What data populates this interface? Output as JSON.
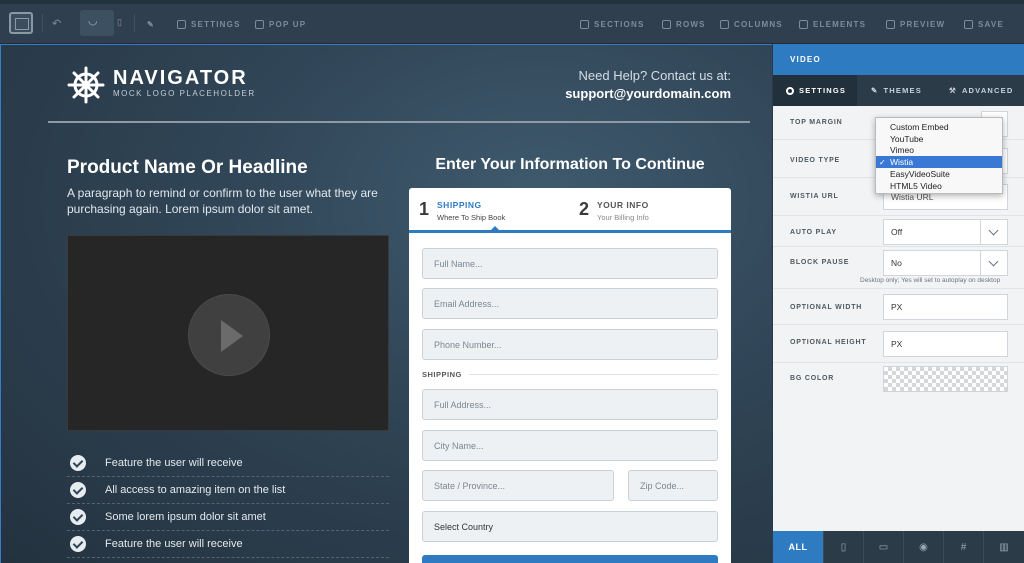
{
  "toolbar": {
    "settings": "SETTINGS",
    "popup": "POP UP",
    "sections": "SECTIONS",
    "rows": "ROWS",
    "columns": "COLUMNS",
    "elements": "ELEMENTS",
    "preview": "PREVIEW",
    "save": "SAVE"
  },
  "page": {
    "brand_name": "NAVIGATOR",
    "brand_sub": "MOCK LOGO PLACEHOLDER",
    "help_line": "Need Help? Contact us at:",
    "help_email": "support@yourdomain.com",
    "headline": "Product Name Or Headline",
    "paragraph": "A paragraph to remind or confirm to the user what they are purchasing again. Lorem ipsum dolor sit amet.",
    "features": [
      "Feature the user will receive",
      "All access to amazing item on the list",
      "Some lorem ipsum dolor sit amet",
      "Feature the user will receive"
    ],
    "form_title": "Enter Your Information To Continue"
  },
  "form": {
    "step1_num": "1",
    "step1_label": "SHIPPING",
    "step1_sub": "Where To Ship Book",
    "step2_num": "2",
    "step2_label": "YOUR INFO",
    "step2_sub": "Your Billing Info",
    "full_name": "Full Name...",
    "email": "Email Address...",
    "phone": "Phone Number...",
    "shipping_label": "SHIPPING",
    "full_address": "Full Address...",
    "city": "City Name...",
    "state": "State / Province...",
    "zip": "Zip Code...",
    "country": "Select Country"
  },
  "panel": {
    "title": "VIDEO",
    "tabs": {
      "settings": "SETTINGS",
      "themes": "THEMES",
      "advanced": "ADVANCED"
    },
    "top_margin_label": "TOP MARGIN",
    "video_type_label": "VIDEO TYPE",
    "wistia_url_label": "WISTIA URL",
    "wistia_url_value": "Wistia URL",
    "auto_play_label": "AUTO PLAY",
    "auto_play_value": "Off",
    "block_pause_label": "BLOCK PAUSE",
    "block_pause_value": "No",
    "block_pause_hint": "Desktop only; Yes will set to autoplay on desktop",
    "opt_width_label": "OPTIONAL WIDTH",
    "opt_width_value": "PX",
    "opt_height_label": "OPTIONAL HEIGHT",
    "opt_height_value": "PX",
    "bg_color_label": "BG COLOR",
    "dropdown_options": [
      "Custom Embed",
      "YouTube",
      "Vimeo",
      "Wistia",
      "EasyVideoSuite",
      "HTML5 Video"
    ],
    "dropdown_selected": "Wistia",
    "bottom_all": "ALL"
  },
  "colors": {
    "accent": "#2f7bc2",
    "toolbar_bg": "#2f3f4f",
    "panel_bg": "#f2f3f4",
    "selection": "#3a78d6"
  }
}
